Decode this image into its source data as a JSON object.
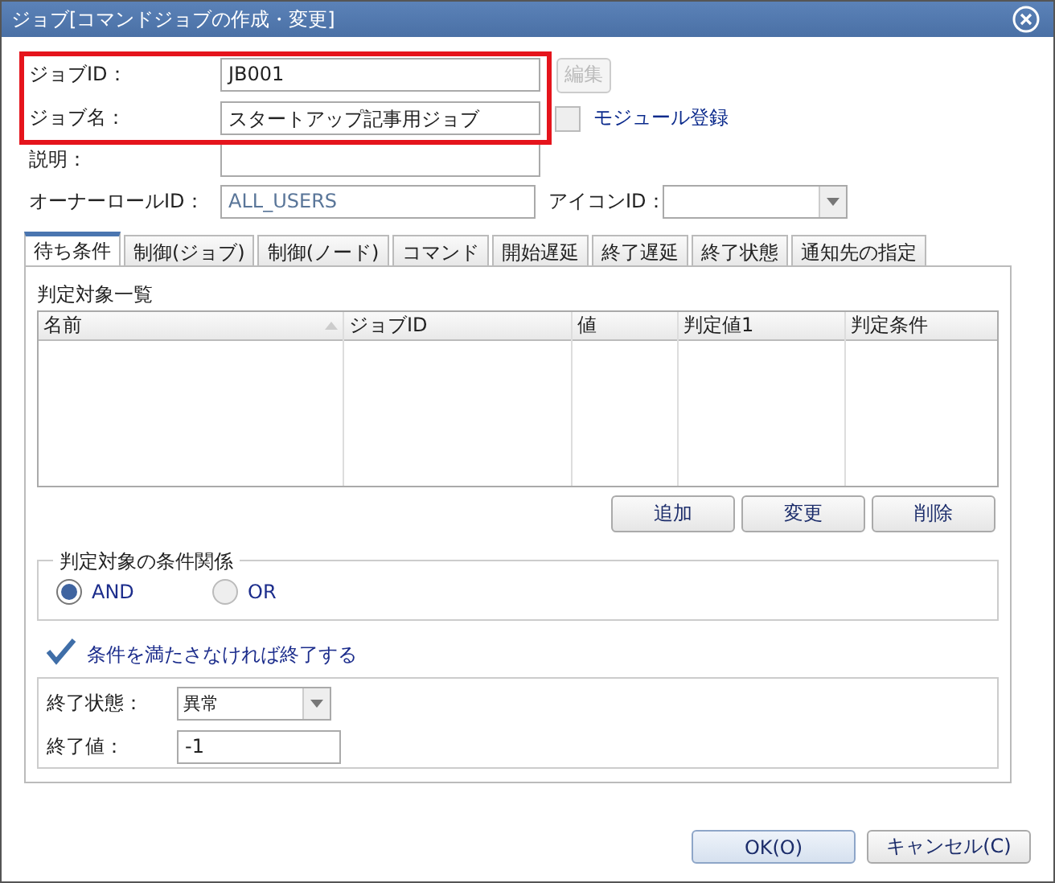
{
  "window": {
    "title": "ジョブ[コマンドジョブの作成・変更]"
  },
  "job_id": {
    "label": "ジョブID：",
    "value": "JB001",
    "highlighted": true
  },
  "edit_button": {
    "label": "編集",
    "disabled": true
  },
  "job_name": {
    "label": "ジョブ名：",
    "value": "スタートアップ記事用ジョブ",
    "highlighted": true
  },
  "module_checkbox": {
    "label": "モジュール登録",
    "checked": false
  },
  "description": {
    "label": "説明："
  },
  "owner_role": {
    "label": "オーナーロールID：",
    "value": "ALL_USERS"
  },
  "icon_id": {
    "label": "アイコンID："
  },
  "tabs": [
    {
      "label": "待ち条件",
      "selected": true
    },
    {
      "label": "制御(ジョブ)",
      "selected": false
    },
    {
      "label": "制御(ノード)",
      "selected": false
    },
    {
      "label": "コマンド",
      "selected": false
    },
    {
      "label": "開始遅延",
      "selected": false
    },
    {
      "label": "終了遅延",
      "selected": false
    },
    {
      "label": "終了状態",
      "selected": false
    },
    {
      "label": "通知先の指定",
      "selected": false
    }
  ],
  "section_title": "判定対象一覧",
  "table": {
    "columns": [
      {
        "label": "名前",
        "sorted": true
      },
      {
        "label": "ジョブID",
        "sorted": false
      },
      {
        "label": "値",
        "sorted": false
      },
      {
        "label": "判定値1",
        "sorted": false
      },
      {
        "label": "判定条件",
        "sorted": false
      }
    ]
  },
  "table_buttons": [
    "追加",
    "変更",
    "削除"
  ],
  "condition_group": {
    "legend": "判定対象の条件関係",
    "options": [
      {
        "label": "AND",
        "selected": true
      },
      {
        "label": "OR",
        "selected": false
      }
    ]
  },
  "end_checkbox": {
    "label": "条件を満たさなければ終了する",
    "checked": true
  },
  "end_status": {
    "label": "終了状態：",
    "value": "異常"
  },
  "end_value": {
    "label": "終了値：",
    "value": "-1"
  },
  "footer_buttons": [
    {
      "label": "OK(O)",
      "default": true
    },
    {
      "label": "キャンセル(C)",
      "default": false
    }
  ]
}
